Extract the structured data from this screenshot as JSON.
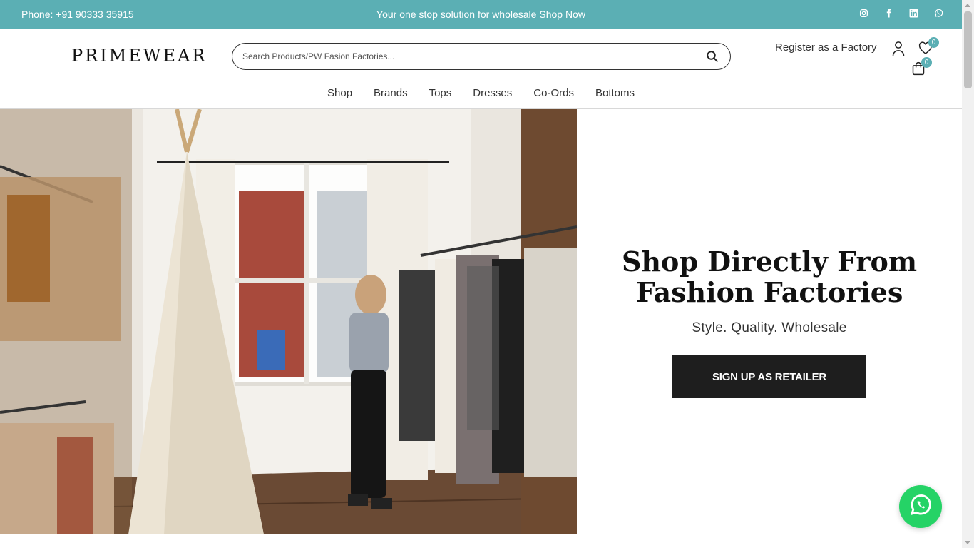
{
  "topbar": {
    "phone": "Phone: +91 90333 35915",
    "promo_text": "Your one stop solution for wholesale ",
    "promo_link": "Shop Now",
    "socials": [
      "instagram-icon",
      "facebook-icon",
      "linkedin-icon",
      "whatsapp-icon"
    ]
  },
  "header": {
    "logo": "PRIMEWEAR",
    "search_placeholder": "Search Products/PW Fasion Factories...",
    "register_label": "Register as a Factory",
    "wishlist_count": "0",
    "cart_count": "0"
  },
  "nav": {
    "items": [
      "Shop",
      "Brands",
      "Tops",
      "Dresses",
      "Co-Ords",
      "Bottoms"
    ]
  },
  "hero": {
    "title_line1": "Shop Directly From",
    "title_line2": "Fashion Factories",
    "subtitle": "Style. Quality. Wholesale",
    "cta_label": "SIGN UP AS RETAILER"
  },
  "colors": {
    "accent": "#5bafb4",
    "cta_bg": "#1e1e1e",
    "whatsapp": "#25d366"
  }
}
